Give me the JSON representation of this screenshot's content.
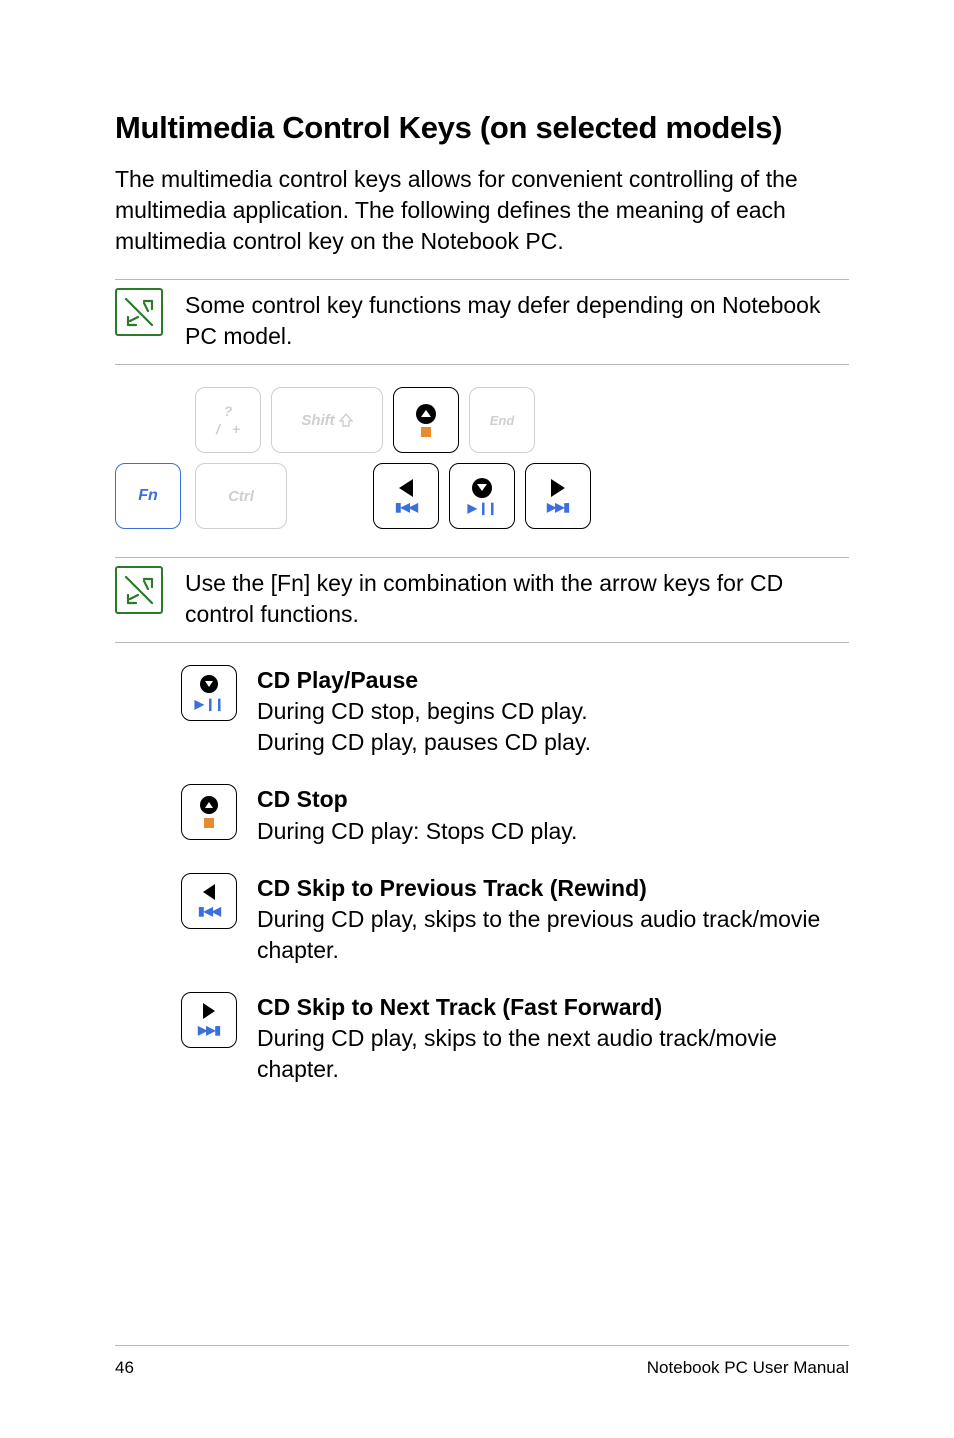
{
  "heading": "Multimedia Control Keys (on selected models)",
  "intro": "The multimedia control keys allows for convenient controlling of the multimedia application. The following defines the meaning of each multimedia control key on the Notebook PC.",
  "note1": "Some control key functions may defer depending on Notebook PC model.",
  "note2": "Use the [Fn] key in combination with the arrow keys for CD control functions.",
  "keys": {
    "fn": "Fn",
    "slash_top": "?",
    "slash_bot_left": "/",
    "slash_bot_right": "+",
    "shift": "Shift",
    "ctrl": "Ctrl",
    "end": "End"
  },
  "defs": {
    "play": {
      "title": "CD Play/Pause",
      "line1": "During CD stop, begins CD play.",
      "line2": "During CD play, pauses CD play."
    },
    "stop": {
      "title": "CD Stop",
      "line1": "During CD play: Stops CD play."
    },
    "prev": {
      "title": "CD Skip to Previous Track (Rewind)",
      "line1": "During CD play, skips to the previous audio track/movie chapter."
    },
    "next": {
      "title": "CD Skip to Next Track (Fast Forward)",
      "line1": "During CD play, skips to the next audio track/movie chapter."
    }
  },
  "footer": {
    "page": "46",
    "manual": "Notebook PC User Manual"
  }
}
